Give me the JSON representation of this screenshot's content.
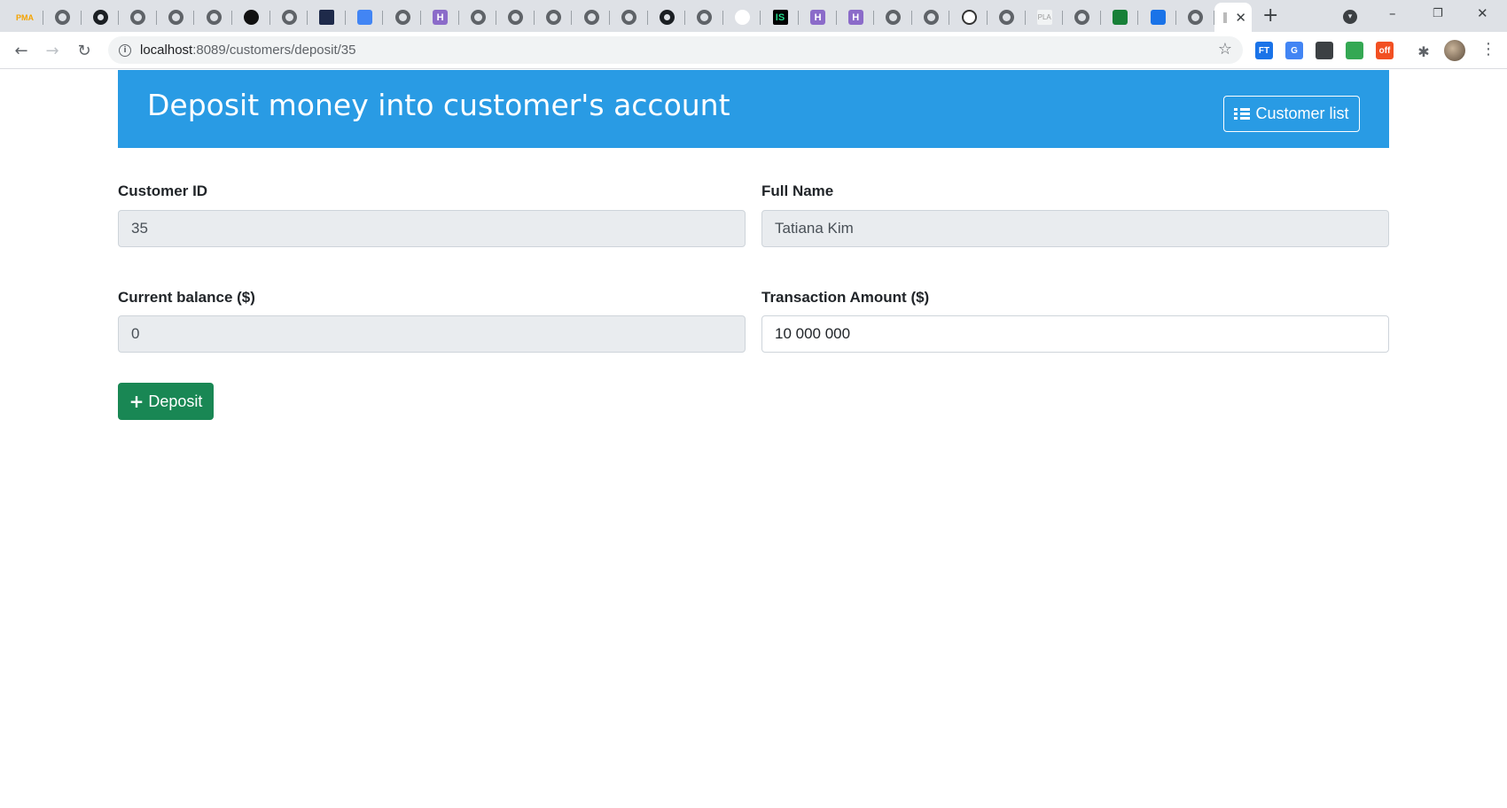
{
  "browser": {
    "url_host": "localhost",
    "url_path": ":8089/customers/deposit/35",
    "tabs": [
      {
        "icon": "phpmyadmin-icon",
        "text": "PMA"
      },
      {
        "icon": "globe-icon",
        "text": ""
      },
      {
        "icon": "github-icon",
        "text": ""
      },
      {
        "icon": "globe-icon",
        "text": ""
      },
      {
        "icon": "globe-icon",
        "text": ""
      },
      {
        "icon": "globe-icon",
        "text": ""
      },
      {
        "icon": "dark-circle-icon",
        "text": ""
      },
      {
        "icon": "globe-icon",
        "text": ""
      },
      {
        "icon": "navy-square-icon",
        "text": ""
      },
      {
        "icon": "translate-icon",
        "text": ""
      },
      {
        "icon": "globe-icon",
        "text": ""
      },
      {
        "icon": "hackerrank-icon",
        "text": "H"
      },
      {
        "icon": "globe-icon",
        "text": ""
      },
      {
        "icon": "globe-icon",
        "text": ""
      },
      {
        "icon": "globe-icon",
        "text": ""
      },
      {
        "icon": "globe-icon",
        "text": ""
      },
      {
        "icon": "globe-icon",
        "text": ""
      },
      {
        "icon": "github-icon",
        "text": ""
      },
      {
        "icon": "globe-icon",
        "text": ""
      },
      {
        "icon": "person-icon",
        "text": ""
      },
      {
        "icon": "jetbrains-icon",
        "text": "IS"
      },
      {
        "icon": "hackerrank-icon",
        "text": "H"
      },
      {
        "icon": "hackerrank-icon",
        "text": "H"
      },
      {
        "icon": "globe-icon",
        "text": ""
      },
      {
        "icon": "globe-icon",
        "text": ""
      },
      {
        "icon": "bw-circle-icon",
        "text": ""
      },
      {
        "icon": "globe-icon",
        "text": ""
      },
      {
        "icon": "pla-icon",
        "text": "PLA"
      },
      {
        "icon": "globe-icon",
        "text": ""
      },
      {
        "icon": "contacts-green-icon",
        "text": ""
      },
      {
        "icon": "contacts-blue-icon",
        "text": ""
      },
      {
        "icon": "globe-icon",
        "text": ""
      }
    ],
    "active_tab_close": "✕",
    "new_tab": "+",
    "extensions": [
      {
        "icon": "ft-extension-icon",
        "text": "FT",
        "color": "#1a73e8"
      },
      {
        "icon": "translate-extension-icon",
        "text": "G",
        "color": "#4285f4"
      },
      {
        "icon": "sync-extension-icon",
        "text": "",
        "color": "#3c4043"
      },
      {
        "icon": "color-extension-icon",
        "text": "",
        "color": "#34a853"
      },
      {
        "icon": "off-extension-icon",
        "text": "off",
        "color": "#f25022"
      }
    ]
  },
  "header": {
    "title": "Deposit money into customer's account",
    "customer_list_button": "Customer list",
    "banner_color": "#299be4"
  },
  "form": {
    "customer_id": {
      "label": "Customer ID",
      "value": "35"
    },
    "full_name": {
      "label": "Full Name",
      "value": "Tatiana Kim"
    },
    "current_balance": {
      "label": "Current balance ($)",
      "value": "0"
    },
    "transaction_amount": {
      "label": "Transaction Amount ($)",
      "value": "10 000 000"
    },
    "deposit_button": "Deposit",
    "deposit_button_color": "#198754"
  }
}
